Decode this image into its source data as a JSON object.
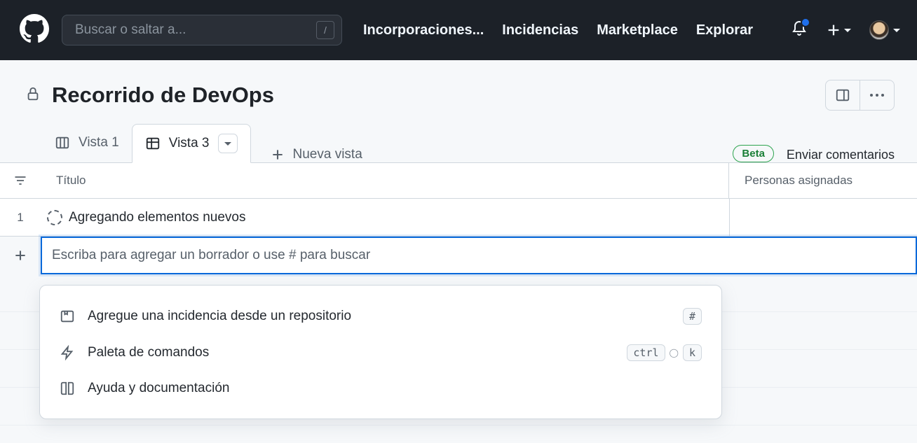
{
  "topbar": {
    "search_placeholder": "Buscar o saltar a...",
    "slash": "/",
    "nav": {
      "pulls": "Incorporaciones...",
      "issues": "Incidencias",
      "marketplace": "Marketplace",
      "explore": "Explorar"
    }
  },
  "header": {
    "title": "Recorrido de DevOps"
  },
  "tabs": {
    "view1": "Vista 1",
    "view3": "Vista 3",
    "new_view": "Nueva vista",
    "beta": "Beta",
    "feedback": "Enviar comentarios"
  },
  "columns": {
    "title": "Título",
    "assignees": "Personas asignadas"
  },
  "rows": [
    {
      "num": "1",
      "title": "Agregando elementos nuevos"
    }
  ],
  "add_row": {
    "placeholder": "Escriba para agregar un borrador o use # para buscar"
  },
  "popover": {
    "add_issue": "Agregue una incidencia desde un repositorio",
    "hash": "#",
    "command_palette": "Paleta de comandos",
    "ctrl": "ctrl",
    "k": "k",
    "help": "Ayuda y documentación"
  }
}
